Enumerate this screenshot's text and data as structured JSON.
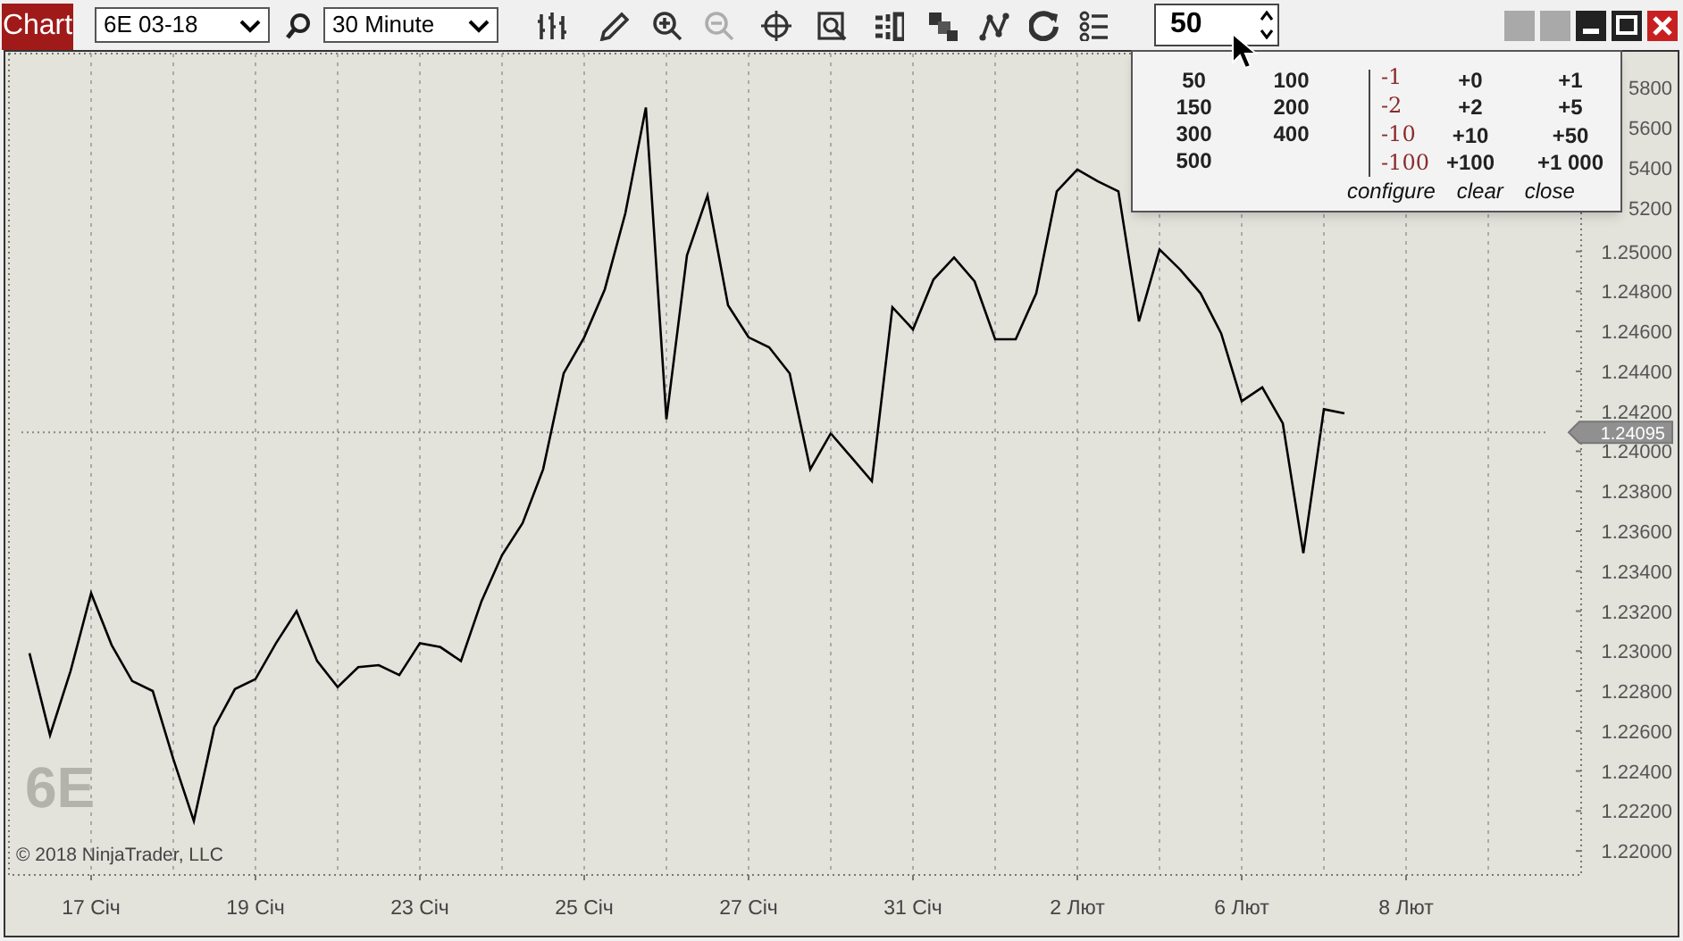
{
  "window": {
    "tab_label": "Chart"
  },
  "toolbar": {
    "instrument": "6E 03-18",
    "interval": "30 Minute",
    "quantity": "50",
    "tools": [
      {
        "kind": "bars",
        "disabled": false
      },
      {
        "kind": "pencil",
        "disabled": false
      },
      {
        "kind": "zoom-in",
        "disabled": false
      },
      {
        "kind": "zoom-out",
        "disabled": true
      },
      {
        "kind": "crosshair",
        "disabled": false
      },
      {
        "kind": "properties",
        "disabled": false
      },
      {
        "kind": "columns",
        "disabled": false
      },
      {
        "kind": "squares",
        "disabled": false
      },
      {
        "kind": "nodes",
        "disabled": false
      },
      {
        "kind": "refresh",
        "disabled": false
      },
      {
        "kind": "list",
        "disabled": false
      }
    ]
  },
  "quantity_popup": {
    "quantities": [
      "50",
      "100",
      "150",
      "200",
      "300",
      "400",
      "500"
    ],
    "decrements": [
      "-1",
      "-2",
      "-10",
      "-100"
    ],
    "increments": [
      "+0",
      "+1",
      "+2",
      "+5",
      "+10",
      "+50",
      "+100",
      "+1 000"
    ],
    "links": [
      "configure",
      "clear",
      "close"
    ]
  },
  "chart": {
    "watermark": "6E",
    "copyright": "© 2018 NinjaTrader, LLC",
    "covered_axis_labels": [
      "5800",
      "5600",
      "5400",
      "5200"
    ],
    "chart_data": {
      "type": "line",
      "grid": true,
      "ylim": [
        1.2188,
        1.2599
      ],
      "ref_lines": [
        {
          "axis": "y",
          "value": 1.24095,
          "label": "1.24095"
        }
      ],
      "categories": [
        null,
        null,
        null,
        null,
        "17 Січ",
        null,
        null,
        null,
        null,
        null,
        null,
        null,
        "19 Січ",
        null,
        null,
        null,
        null,
        null,
        null,
        null,
        "23 Січ",
        null,
        null,
        null,
        null,
        null,
        null,
        null,
        "25 Січ",
        null,
        null,
        null,
        null,
        null,
        null,
        null,
        "27 Січ",
        null,
        null,
        null,
        null,
        null,
        null,
        null,
        "31 Січ",
        null,
        null,
        null,
        null,
        null,
        null,
        null,
        "2 Лют",
        null,
        null,
        null,
        null,
        null,
        null,
        null,
        "6 Лют",
        null,
        null,
        null,
        null,
        null,
        null,
        null,
        "8 Лют"
      ],
      "yticks": [
        {
          "value": 1.22,
          "label": "1.22000"
        },
        {
          "value": 1.222,
          "label": "1.22200"
        },
        {
          "value": 1.224,
          "label": "1.22400"
        },
        {
          "value": 1.226,
          "label": "1.22600"
        },
        {
          "value": 1.228,
          "label": "1.22800"
        },
        {
          "value": 1.23,
          "label": "1.23000"
        },
        {
          "value": 1.232,
          "label": "1.23200"
        },
        {
          "value": 1.234,
          "label": "1.23400"
        },
        {
          "value": 1.236,
          "label": "1.23600"
        },
        {
          "value": 1.238,
          "label": "1.23800"
        },
        {
          "value": 1.24,
          "label": "1.24000"
        },
        {
          "value": 1.242,
          "label": "1.24200"
        },
        {
          "value": 1.244,
          "label": "1.24400"
        },
        {
          "value": 1.246,
          "label": "1.24600"
        },
        {
          "value": 1.248,
          "label": "1.24800"
        },
        {
          "value": 1.25,
          "label": "1.25000"
        }
      ],
      "series": [
        {
          "color": "#000000",
          "values": [
            null,
            1.2299,
            1.2258,
            1.229,
            1.2329,
            1.2303,
            1.2285,
            1.228,
            1.2246,
            1.2215,
            1.2262,
            1.2281,
            1.2286,
            1.2304,
            1.232,
            1.2295,
            1.2282,
            1.2292,
            1.2293,
            1.2288,
            1.2304,
            1.2302,
            1.2295,
            1.2325,
            1.2348,
            1.2364,
            1.2391,
            1.2439,
            1.2457,
            1.2481,
            1.2519,
            1.2572,
            1.2416,
            1.2498,
            1.2528,
            1.2473,
            1.2457,
            1.2452,
            1.2439,
            1.2391,
            1.2409,
            1.2397,
            1.2385,
            1.2472,
            1.2461,
            1.2486,
            1.2497,
            1.2485,
            1.2456,
            1.2456,
            1.2479,
            1.253,
            1.2541,
            1.2535,
            1.253,
            1.2465,
            1.2501,
            1.2491,
            1.2479,
            1.2459,
            1.2425,
            1.2432,
            1.2414,
            1.2349,
            1.2421,
            1.2419,
            null,
            null,
            null
          ]
        }
      ]
    }
  }
}
